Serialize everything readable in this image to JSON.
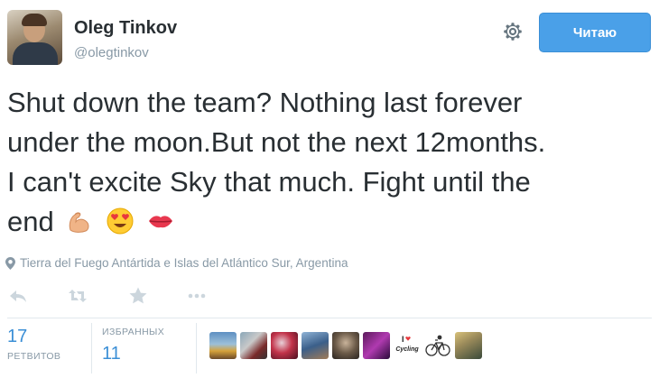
{
  "user": {
    "name": "Oleg Tinkov",
    "handle": "@olegtinkov"
  },
  "follow_button": {
    "label": "Читаю"
  },
  "tweet": {
    "line1": "Shut down the team? Nothing last forever",
    "line2": "under the moon.But not the next 12months.",
    "line3": "I can't excite Sky that much. Fight until the",
    "line4": "end",
    "emojis": [
      "flexed-biceps-emoji",
      "heart-eyes-emoji",
      "kiss-lips-emoji"
    ]
  },
  "location": {
    "text": "Tierra del Fuego Antártida e Islas del Atlántico Sur, Argentina"
  },
  "actions": [
    "reply-icon",
    "retweet-icon",
    "favorite-icon",
    "more-icon"
  ],
  "stats": {
    "retweets_count": "17",
    "retweets_label": "РЕТВИТОВ",
    "favorites_label": "ИЗБРАННЫХ",
    "favorites_count": "11"
  },
  "favoriters": [
    "avatar-mountain",
    "avatar-cyclist",
    "avatar-red",
    "avatar-blue",
    "avatar-man",
    "avatar-purple",
    "avatar-i-love-cycling",
    "avatar-bike-sketch",
    "avatar-portrait"
  ],
  "favoriter_text": {
    "i_love_cycling": "Cycling"
  },
  "colors": {
    "accent": "#4aa0e8",
    "link": "#3b8fd6",
    "muted": "#8899a6",
    "text": "#292f33"
  }
}
